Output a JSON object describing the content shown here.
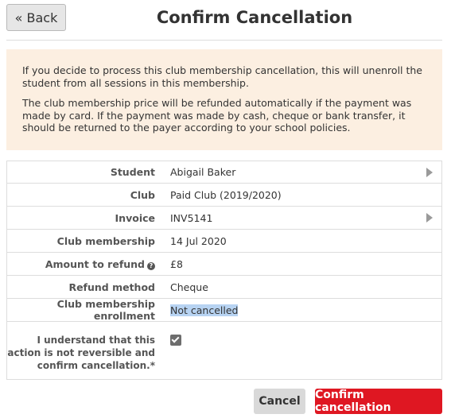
{
  "header": {
    "back_label": "« Back",
    "title": "Confirm Cancellation"
  },
  "notice": {
    "paragraph1": "If you decide to process this club membership cancellation, this will unenroll the student from all sessions in this membership.",
    "paragraph2": "The club membership price will be refunded automatically if the payment was made by card. If the payment was made by cash, cheque or bank transfer, it should be returned to the payer according to your school policies."
  },
  "details": {
    "student": {
      "label": "Student",
      "value": "Abigail Baker"
    },
    "club": {
      "label": "Club",
      "value": "Paid Club (2019/2020)"
    },
    "invoice": {
      "label": "Invoice",
      "value": "INV5141"
    },
    "membership": {
      "label": "Club membership",
      "value": "14 Jul 2020"
    },
    "amount": {
      "label": "Amount to refund",
      "value": "£8",
      "help_icon": "?"
    },
    "method": {
      "label": "Refund method",
      "value": "Cheque"
    },
    "enrollment": {
      "label": "Club membership enrollment",
      "value": "Not cancelled"
    },
    "confirm": {
      "label": "I understand that this action is not reversible and confirm cancellation.*",
      "checked": true
    }
  },
  "actions": {
    "cancel_label": "Cancel",
    "confirm_label": "Confirm cancellation"
  },
  "colors": {
    "notice_bg": "#fcefe1",
    "danger": "#df1722",
    "highlight": "#b7d3f2"
  }
}
